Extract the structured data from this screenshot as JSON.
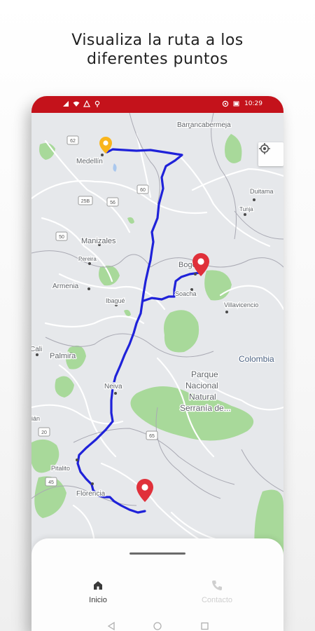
{
  "headline": {
    "line1": "Visualiza la ruta a los",
    "line2": "diferentes puntos"
  },
  "status_bar": {
    "time": "10:29",
    "left_icons": [
      "signal-icon",
      "wifi-icon",
      "alert-icon",
      "location-icon"
    ],
    "right_icons": [
      "location-pin-icon",
      "battery-icon"
    ]
  },
  "map": {
    "place_labels": {
      "barrancabermeja": "Barrancabermeja",
      "medellin": "Medellín",
      "duitama": "Duitama",
      "manizales": "Manizales",
      "pereira": "Pereira",
      "armenia": "Armenia",
      "ibague": "Ibagué",
      "bogota": "Bogotá",
      "soacha": "Soacha",
      "villavicencio": "Villavicencio",
      "colombia": "Colombia",
      "cali": "Cali",
      "palmira": "Palmira",
      "neiva": "Neiva",
      "park_line1": "Parque",
      "park_line2": "Nacional",
      "park_line3": "Natural",
      "park_line4": "Serranía de...",
      "pitalito": "Pitalito",
      "florencia": "Florencia",
      "tunja": "Tunja",
      "edge_label": "ián"
    },
    "road_shields": {
      "r62": "62",
      "r60": "60",
      "r25b": "25B",
      "r56": "56",
      "r50": "50",
      "r65": "65",
      "r45": "45",
      "r20": "20"
    },
    "markers": [
      {
        "name": "origin",
        "color": "#f9b51c"
      },
      {
        "name": "bogota",
        "color": "#e0303a"
      },
      {
        "name": "florencia",
        "color": "#e0303a"
      }
    ],
    "route_color": "#1f22d9",
    "my_location_icon": "my-location-icon"
  },
  "bottom_nav": {
    "home_label": "Inicio",
    "home_icon": "home-icon",
    "contact_label": "Contacto",
    "contact_icon": "phone-icon"
  },
  "system_nav": [
    "back-icon",
    "home-circle-icon",
    "recents-icon"
  ],
  "colors": {
    "status_bar": "#c4121b",
    "land": "#e6e8eb",
    "park_green": "#a8d99a",
    "roads": "#ffffff",
    "borders": "#a9a9b3"
  }
}
